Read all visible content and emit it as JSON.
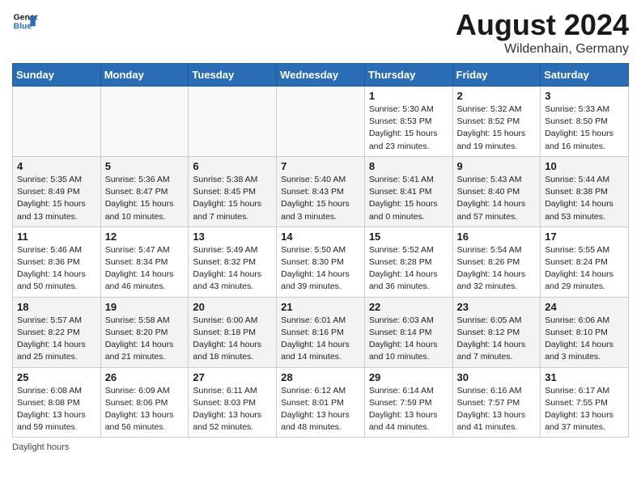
{
  "header": {
    "logo_line1": "General",
    "logo_line2": "Blue",
    "month": "August 2024",
    "location": "Wildenhain, Germany"
  },
  "weekdays": [
    "Sunday",
    "Monday",
    "Tuesday",
    "Wednesday",
    "Thursday",
    "Friday",
    "Saturday"
  ],
  "weeks": [
    [
      {
        "day": "",
        "info": ""
      },
      {
        "day": "",
        "info": ""
      },
      {
        "day": "",
        "info": ""
      },
      {
        "day": "",
        "info": ""
      },
      {
        "day": "1",
        "info": "Sunrise: 5:30 AM\nSunset: 8:53 PM\nDaylight: 15 hours\nand 23 minutes."
      },
      {
        "day": "2",
        "info": "Sunrise: 5:32 AM\nSunset: 8:52 PM\nDaylight: 15 hours\nand 19 minutes."
      },
      {
        "day": "3",
        "info": "Sunrise: 5:33 AM\nSunset: 8:50 PM\nDaylight: 15 hours\nand 16 minutes."
      }
    ],
    [
      {
        "day": "4",
        "info": "Sunrise: 5:35 AM\nSunset: 8:49 PM\nDaylight: 15 hours\nand 13 minutes."
      },
      {
        "day": "5",
        "info": "Sunrise: 5:36 AM\nSunset: 8:47 PM\nDaylight: 15 hours\nand 10 minutes."
      },
      {
        "day": "6",
        "info": "Sunrise: 5:38 AM\nSunset: 8:45 PM\nDaylight: 15 hours\nand 7 minutes."
      },
      {
        "day": "7",
        "info": "Sunrise: 5:40 AM\nSunset: 8:43 PM\nDaylight: 15 hours\nand 3 minutes."
      },
      {
        "day": "8",
        "info": "Sunrise: 5:41 AM\nSunset: 8:41 PM\nDaylight: 15 hours\nand 0 minutes."
      },
      {
        "day": "9",
        "info": "Sunrise: 5:43 AM\nSunset: 8:40 PM\nDaylight: 14 hours\nand 57 minutes."
      },
      {
        "day": "10",
        "info": "Sunrise: 5:44 AM\nSunset: 8:38 PM\nDaylight: 14 hours\nand 53 minutes."
      }
    ],
    [
      {
        "day": "11",
        "info": "Sunrise: 5:46 AM\nSunset: 8:36 PM\nDaylight: 14 hours\nand 50 minutes."
      },
      {
        "day": "12",
        "info": "Sunrise: 5:47 AM\nSunset: 8:34 PM\nDaylight: 14 hours\nand 46 minutes."
      },
      {
        "day": "13",
        "info": "Sunrise: 5:49 AM\nSunset: 8:32 PM\nDaylight: 14 hours\nand 43 minutes."
      },
      {
        "day": "14",
        "info": "Sunrise: 5:50 AM\nSunset: 8:30 PM\nDaylight: 14 hours\nand 39 minutes."
      },
      {
        "day": "15",
        "info": "Sunrise: 5:52 AM\nSunset: 8:28 PM\nDaylight: 14 hours\nand 36 minutes."
      },
      {
        "day": "16",
        "info": "Sunrise: 5:54 AM\nSunset: 8:26 PM\nDaylight: 14 hours\nand 32 minutes."
      },
      {
        "day": "17",
        "info": "Sunrise: 5:55 AM\nSunset: 8:24 PM\nDaylight: 14 hours\nand 29 minutes."
      }
    ],
    [
      {
        "day": "18",
        "info": "Sunrise: 5:57 AM\nSunset: 8:22 PM\nDaylight: 14 hours\nand 25 minutes."
      },
      {
        "day": "19",
        "info": "Sunrise: 5:58 AM\nSunset: 8:20 PM\nDaylight: 14 hours\nand 21 minutes."
      },
      {
        "day": "20",
        "info": "Sunrise: 6:00 AM\nSunset: 8:18 PM\nDaylight: 14 hours\nand 18 minutes."
      },
      {
        "day": "21",
        "info": "Sunrise: 6:01 AM\nSunset: 8:16 PM\nDaylight: 14 hours\nand 14 minutes."
      },
      {
        "day": "22",
        "info": "Sunrise: 6:03 AM\nSunset: 8:14 PM\nDaylight: 14 hours\nand 10 minutes."
      },
      {
        "day": "23",
        "info": "Sunrise: 6:05 AM\nSunset: 8:12 PM\nDaylight: 14 hours\nand 7 minutes."
      },
      {
        "day": "24",
        "info": "Sunrise: 6:06 AM\nSunset: 8:10 PM\nDaylight: 14 hours\nand 3 minutes."
      }
    ],
    [
      {
        "day": "25",
        "info": "Sunrise: 6:08 AM\nSunset: 8:08 PM\nDaylight: 13 hours\nand 59 minutes."
      },
      {
        "day": "26",
        "info": "Sunrise: 6:09 AM\nSunset: 8:06 PM\nDaylight: 13 hours\nand 56 minutes."
      },
      {
        "day": "27",
        "info": "Sunrise: 6:11 AM\nSunset: 8:03 PM\nDaylight: 13 hours\nand 52 minutes."
      },
      {
        "day": "28",
        "info": "Sunrise: 6:12 AM\nSunset: 8:01 PM\nDaylight: 13 hours\nand 48 minutes."
      },
      {
        "day": "29",
        "info": "Sunrise: 6:14 AM\nSunset: 7:59 PM\nDaylight: 13 hours\nand 44 minutes."
      },
      {
        "day": "30",
        "info": "Sunrise: 6:16 AM\nSunset: 7:57 PM\nDaylight: 13 hours\nand 41 minutes."
      },
      {
        "day": "31",
        "info": "Sunrise: 6:17 AM\nSunset: 7:55 PM\nDaylight: 13 hours\nand 37 minutes."
      }
    ]
  ],
  "footer": "Daylight hours"
}
